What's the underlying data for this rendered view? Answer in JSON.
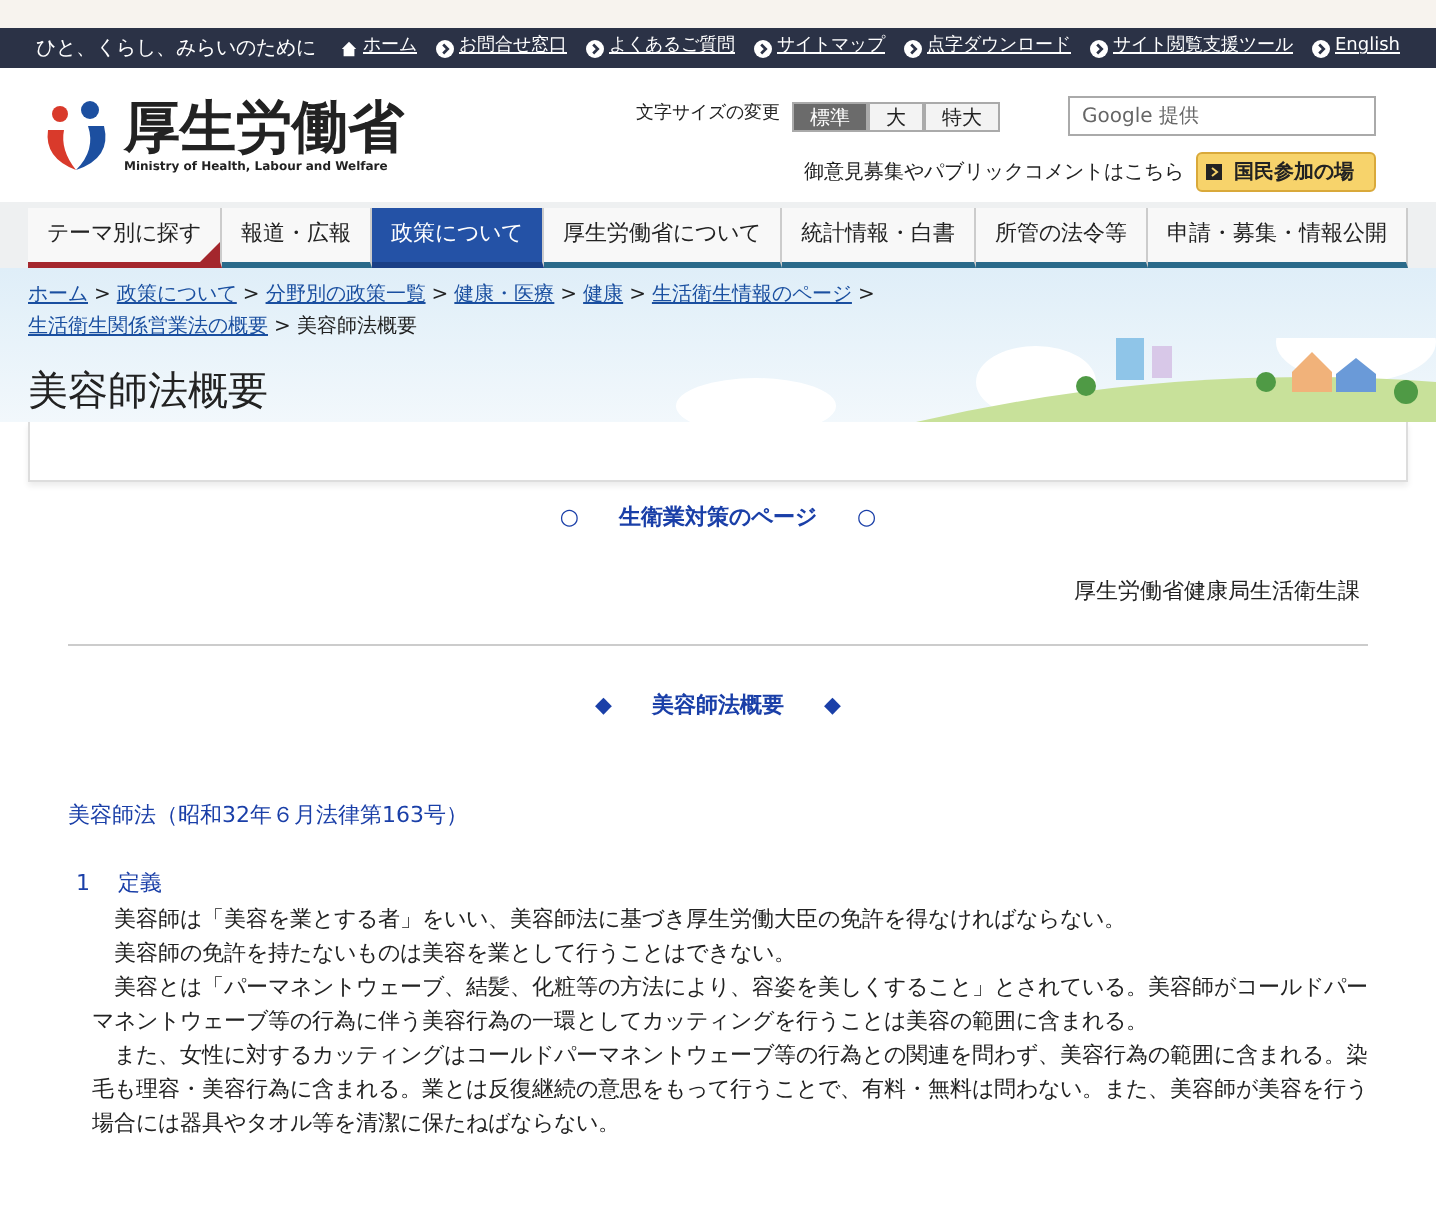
{
  "top_bar": {
    "tagline": "ひと、くらし、みらいのために",
    "links": [
      {
        "label": "ホーム",
        "kind": "home"
      },
      {
        "label": "お問合せ窓口",
        "kind": "arrow"
      },
      {
        "label": "よくあるご質問",
        "kind": "arrow"
      },
      {
        "label": "サイトマップ",
        "kind": "arrow"
      },
      {
        "label": "点字ダウンロード",
        "kind": "arrow"
      },
      {
        "label": "サイト閲覧支援ツール",
        "kind": "arrow"
      },
      {
        "label": "English",
        "kind": "arrow"
      }
    ]
  },
  "header": {
    "logo_title": "厚生労働省",
    "logo_subtitle": "Ministry of Health, Labour and Welfare",
    "font_size_label": "文字サイズの変更",
    "font_sizes": [
      {
        "label": "標準",
        "selected": true
      },
      {
        "label": "大",
        "selected": false
      },
      {
        "label": "特大",
        "selected": false
      }
    ],
    "search": {
      "placeholder": "Google 提供"
    },
    "public_comment": "御意見募集やパブリックコメントはこちら",
    "participation_button": "国民参加の場"
  },
  "nav": [
    {
      "label": "テーマ別に探す",
      "selected": false,
      "kind": "theme"
    },
    {
      "label": "報道・広報",
      "selected": false,
      "kind": "normal"
    },
    {
      "label": "政策について",
      "selected": true,
      "kind": "normal"
    },
    {
      "label": "厚生労働省について",
      "selected": false,
      "kind": "normal"
    },
    {
      "label": "統計情報・白書",
      "selected": false,
      "kind": "normal"
    },
    {
      "label": "所管の法令等",
      "selected": false,
      "kind": "normal"
    },
    {
      "label": "申請・募集・情報公開",
      "selected": false,
      "kind": "normal"
    }
  ],
  "breadcrumb_separator": ">",
  "breadcrumbs": [
    {
      "label": "ホーム",
      "kind": "link"
    },
    {
      "label": "政策について",
      "kind": "link"
    },
    {
      "label": "分野別の政策一覧",
      "kind": "link"
    },
    {
      "label": "健康・医療",
      "kind": "link"
    },
    {
      "label": "健康",
      "kind": "link"
    },
    {
      "label": "生活衛生情報のページ",
      "kind": "link"
    },
    {
      "label": "生活衛生関係営業法の概要",
      "kind": "link"
    },
    {
      "label": "美容師法概要",
      "kind": "current"
    }
  ],
  "page_title": "美容師法概要",
  "content": {
    "top_link": {
      "left": "○",
      "label": "生衛業対策のページ",
      "right": "○"
    },
    "bureau": "厚生労働省健康局生活衛生課",
    "section_heading": {
      "left": "◆",
      "label": "美容師法概要",
      "right": "◆"
    },
    "law_title": "美容師法（昭和32年６月法律第163号）",
    "item_number": "1",
    "item_title": "定義",
    "paragraphs": [
      "美容師は「美容を業とする者」をいい、美容師法に基づき厚生労働大臣の免許を得なければならない。",
      "美容師の免許を持たないものは美容を業として行うことはできない。",
      "美容とは「パーマネントウェーブ、結髪、化粧等の方法により、容姿を美しくすること」とされている。美容師がコールドパーマネントウェーブ等の行為に伴う美容行為の一環としてカッティングを行うことは美容の範囲に含まれる。",
      "また、女性に対するカッティングはコールドパーマネントウェーブ等の行為との関連を問わず、美容行為の範囲に含まれる。染毛も理容・美容行為に含まれる。業とは反復継続の意思をもって行うことで、有料・無料は問わない。また、美容師が美容を行う場合には器具やタオル等を清潔に保たねばならない。"
    ]
  }
}
